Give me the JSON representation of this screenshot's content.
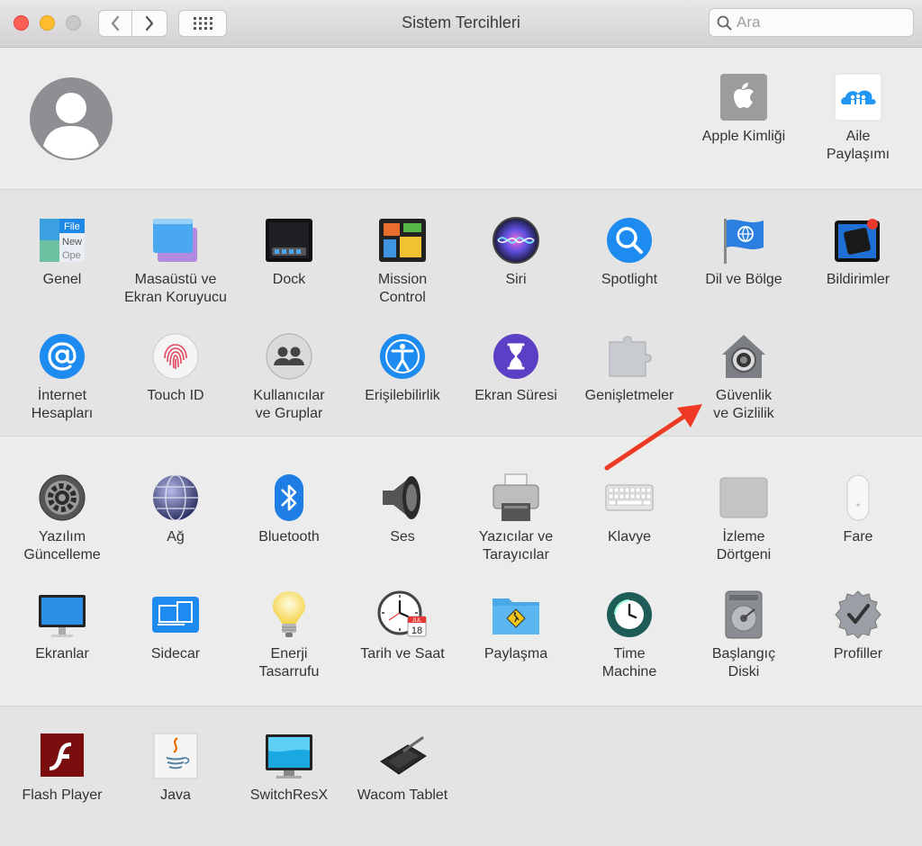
{
  "window": {
    "title": "Sistem Tercihleri"
  },
  "search": {
    "placeholder": "Ara"
  },
  "account": {
    "items": [
      {
        "id": "apple-id",
        "label": "Apple Kimliği"
      },
      {
        "id": "family-sharing",
        "label": "Aile\nPaylaşımı"
      }
    ]
  },
  "personal": {
    "items": [
      {
        "id": "general",
        "label": "Genel"
      },
      {
        "id": "desktop",
        "label": "Masaüstü ve\nEkran Koruyucu"
      },
      {
        "id": "dock",
        "label": "Dock"
      },
      {
        "id": "mission-control",
        "label": "Mission\nControl"
      },
      {
        "id": "siri",
        "label": "Siri"
      },
      {
        "id": "spotlight",
        "label": "Spotlight"
      },
      {
        "id": "language",
        "label": "Dil ve Bölge"
      },
      {
        "id": "notifications",
        "label": "Bildirimler"
      },
      {
        "id": "internet-accounts",
        "label": "İnternet\nHesapları"
      },
      {
        "id": "touch-id",
        "label": "Touch ID"
      },
      {
        "id": "users",
        "label": "Kullanıcılar\nve Gruplar"
      },
      {
        "id": "accessibility",
        "label": "Erişilebilirlik"
      },
      {
        "id": "screen-time",
        "label": "Ekran Süresi"
      },
      {
        "id": "extensions",
        "label": "Genişletmeler"
      },
      {
        "id": "security",
        "label": "Güvenlik\nve Gizlilik"
      }
    ]
  },
  "hardware": {
    "items": [
      {
        "id": "software-update",
        "label": "Yazılım\nGüncelleme"
      },
      {
        "id": "network",
        "label": "Ağ"
      },
      {
        "id": "bluetooth",
        "label": "Bluetooth"
      },
      {
        "id": "sound",
        "label": "Ses"
      },
      {
        "id": "printers",
        "label": "Yazıcılar ve\nTarayıcılar"
      },
      {
        "id": "keyboard",
        "label": "Klavye"
      },
      {
        "id": "trackpad",
        "label": "İzleme\nDörtgeni"
      },
      {
        "id": "mouse",
        "label": "Fare"
      },
      {
        "id": "displays",
        "label": "Ekranlar"
      },
      {
        "id": "sidecar",
        "label": "Sidecar"
      },
      {
        "id": "energy",
        "label": "Enerji\nTasarrufu"
      },
      {
        "id": "date-time",
        "label": "Tarih ve Saat"
      },
      {
        "id": "sharing",
        "label": "Paylaşma"
      },
      {
        "id": "time-machine",
        "label": "Time\nMachine"
      },
      {
        "id": "startup-disk",
        "label": "Başlangıç\nDiski"
      },
      {
        "id": "profiles",
        "label": "Profiller"
      }
    ]
  },
  "other": {
    "items": [
      {
        "id": "flash-player",
        "label": "Flash Player"
      },
      {
        "id": "java",
        "label": "Java"
      },
      {
        "id": "switchresx",
        "label": "SwitchResX"
      },
      {
        "id": "wacom",
        "label": "Wacom Tablet"
      }
    ]
  },
  "icon_text": {
    "general_top": "File",
    "general_mid": "New",
    "general_bot": "Ope",
    "calendar_month": "JUL",
    "calendar_day": "18"
  },
  "colors": {
    "annotation_arrow": "#ee3a24",
    "accent": "#1e88f0"
  }
}
